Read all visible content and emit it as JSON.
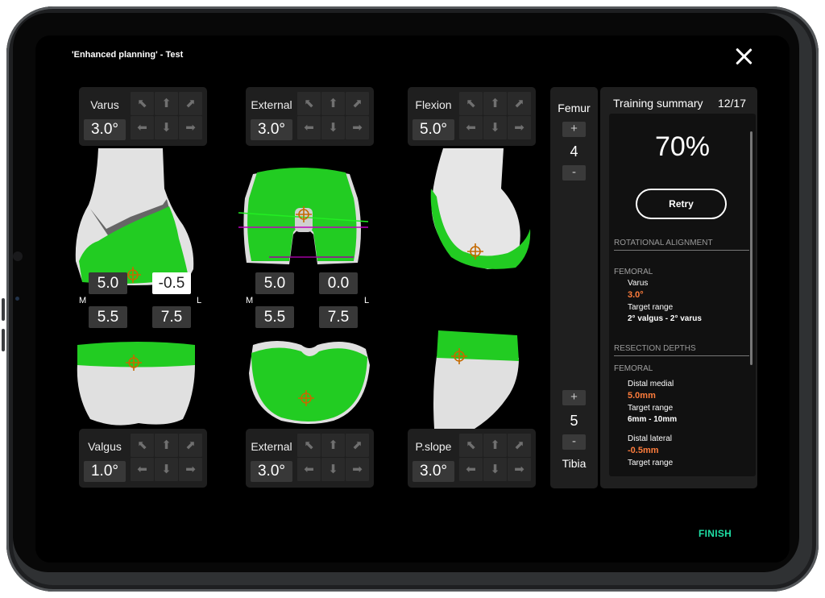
{
  "app": {
    "title": "'Enhanced planning' - Test"
  },
  "controls": {
    "varus": {
      "label": "Varus",
      "value": "3.0°"
    },
    "external_top": {
      "label": "External",
      "value": "3.0°"
    },
    "flexion": {
      "label": "Flexion",
      "value": "5.0°"
    },
    "valgus": {
      "label": "Valgus",
      "value": "1.0°"
    },
    "external_bottom": {
      "label": "External",
      "value": "3.0°"
    },
    "pslope": {
      "label": "P.slope",
      "value": "3.0°"
    }
  },
  "arrows": {
    "up_left": "⬉",
    "up": "⬆",
    "up_right": "⬈",
    "left": "⬅",
    "down": "⬇",
    "right": "➡"
  },
  "measurements": {
    "left_top_m": "5.0",
    "left_top_l": "-0.5",
    "left_bot_m": "5.5",
    "left_bot_l": "7.5",
    "mid_top_m": "5.0",
    "mid_top_l": "0.0",
    "mid_bot_m": "5.5",
    "mid_bot_l": "7.5",
    "m_label": "M",
    "l_label": "L"
  },
  "size_panel": {
    "femur_label": "Femur",
    "femur_value": "4",
    "tibia_label": "Tibia",
    "tibia_value": "5",
    "plus": "+",
    "minus": "-"
  },
  "summary": {
    "title": "Training summary",
    "count": "12/17",
    "score": "70%",
    "retry_label": "Retry",
    "rot_heading": "ROTATIONAL ALIGNMENT",
    "femoral_1": "FEMORAL",
    "varus_label": "Varus",
    "varus_value": "3.0°",
    "target_range_1": "Target range",
    "varus_range": "2° valgus - 2° varus",
    "res_heading": "RESECTION DEPTHS",
    "femoral_2": "FEMORAL",
    "distal_medial_label": "Distal medial",
    "distal_medial_value": "5.0mm",
    "target_range_2": "Target range",
    "distal_medial_range": "6mm - 10mm",
    "distal_lateral_label": "Distal lateral",
    "distal_lateral_value": "-0.5mm",
    "target_range_3": "Target range"
  },
  "finish_label": "FINISH",
  "colors": {
    "implant_green": "#22cc22",
    "bone": "#e6e6e6",
    "accent": "#1fe0a6",
    "value_orange": "#ff7d3c"
  }
}
